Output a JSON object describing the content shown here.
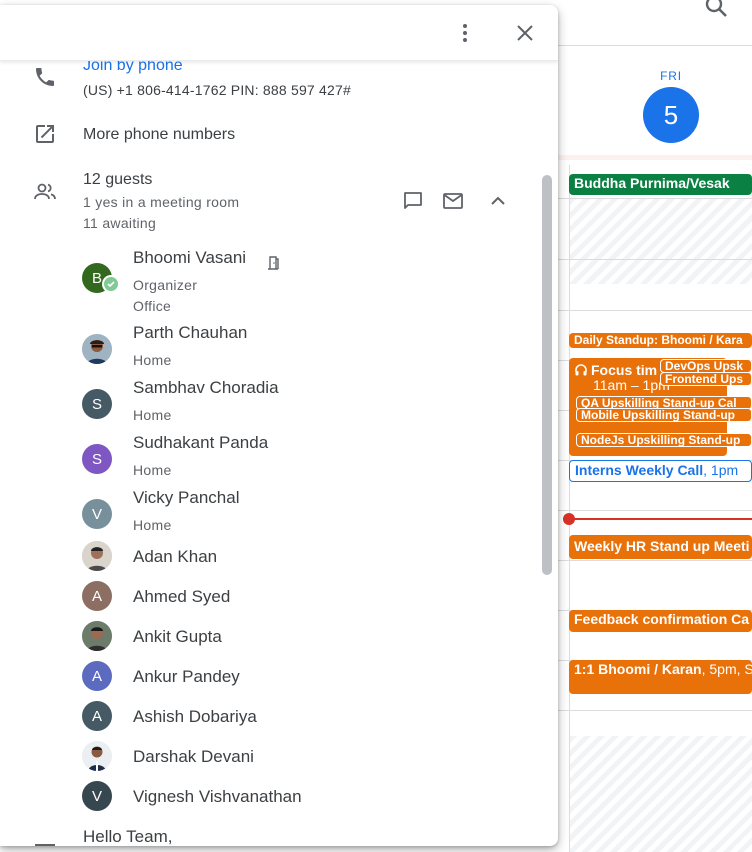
{
  "calendar": {
    "day_name": "FRI",
    "day_number": "5",
    "events": {
      "allday": "Buddha Purnima/Vesak",
      "standup": "Daily Standup: Bhoomi / Kara",
      "focus_title": "Focus tim",
      "focus_time": "11am – 1pm",
      "devops": "DevOps Upsk",
      "frontend": "Frontend Ups",
      "qa": "QA Upskilling Stand-up Cal",
      "mobile": "Mobile Upskilling Stand-up",
      "nodejs": "NodeJs Upskilling Stand-up",
      "interns_title": "Interns Weekly Call",
      "interns_time": ", 1pm",
      "hr": "Weekly HR Stand up Meeti",
      "feedback": "Feedback confirmation Ca",
      "oneone_title": "1:1 Bhoomi / Karan",
      "oneone_time": ", 5pm, S"
    },
    "colors": {
      "primary": "#1a73e8",
      "orange": "#e8710a",
      "green": "#0b8043",
      "now": "#d93025"
    }
  },
  "popup": {
    "join_by_phone": "Join by phone",
    "phone_detail": "(US) +1 806-414-1762 PIN: 888 597 427#",
    "more_phone_numbers": "More phone numbers",
    "guests": {
      "count_label": "12 guests",
      "yes_label": "1 yes in a meeting room",
      "awaiting_label": "11 awaiting",
      "list": [
        {
          "name": "Bhoomi Vasani",
          "role": "Organizer",
          "location": "Office",
          "initial": "B",
          "color": "#33691e",
          "accepted": true
        },
        {
          "name": "Parth Chauhan",
          "location": "Home",
          "photo": true
        },
        {
          "name": "Sambhav Choradia",
          "location": "Home",
          "initial": "S",
          "color": "#455a64"
        },
        {
          "name": "Sudhakant Panda",
          "location": "Home",
          "initial": "S",
          "color": "#7e57c2"
        },
        {
          "name": "Vicky Panchal",
          "location": "Home",
          "initial": "V",
          "color": "#78909c"
        },
        {
          "name": "Adan Khan",
          "photo": true
        },
        {
          "name": "Ahmed Syed",
          "initial": "A",
          "color": "#8d6e63"
        },
        {
          "name": "Ankit Gupta",
          "photo": true
        },
        {
          "name": "Ankur Pandey",
          "initial": "A",
          "color": "#5c6bc0"
        },
        {
          "name": "Ashish Dobariya",
          "initial": "A",
          "color": "#455a64"
        },
        {
          "name": "Darshak Devani",
          "photo": true
        },
        {
          "name": "Vignesh Vishvanathan",
          "initial": "V",
          "color": "#37474f"
        }
      ]
    },
    "description_start": "Hello Team,",
    "icons": [
      "more-vert-icon",
      "close-icon",
      "phone-icon",
      "open-in-new-icon",
      "people-icon",
      "chat-icon",
      "mail-icon",
      "chevron-up-icon",
      "meeting-room-icon",
      "search-icon"
    ]
  }
}
